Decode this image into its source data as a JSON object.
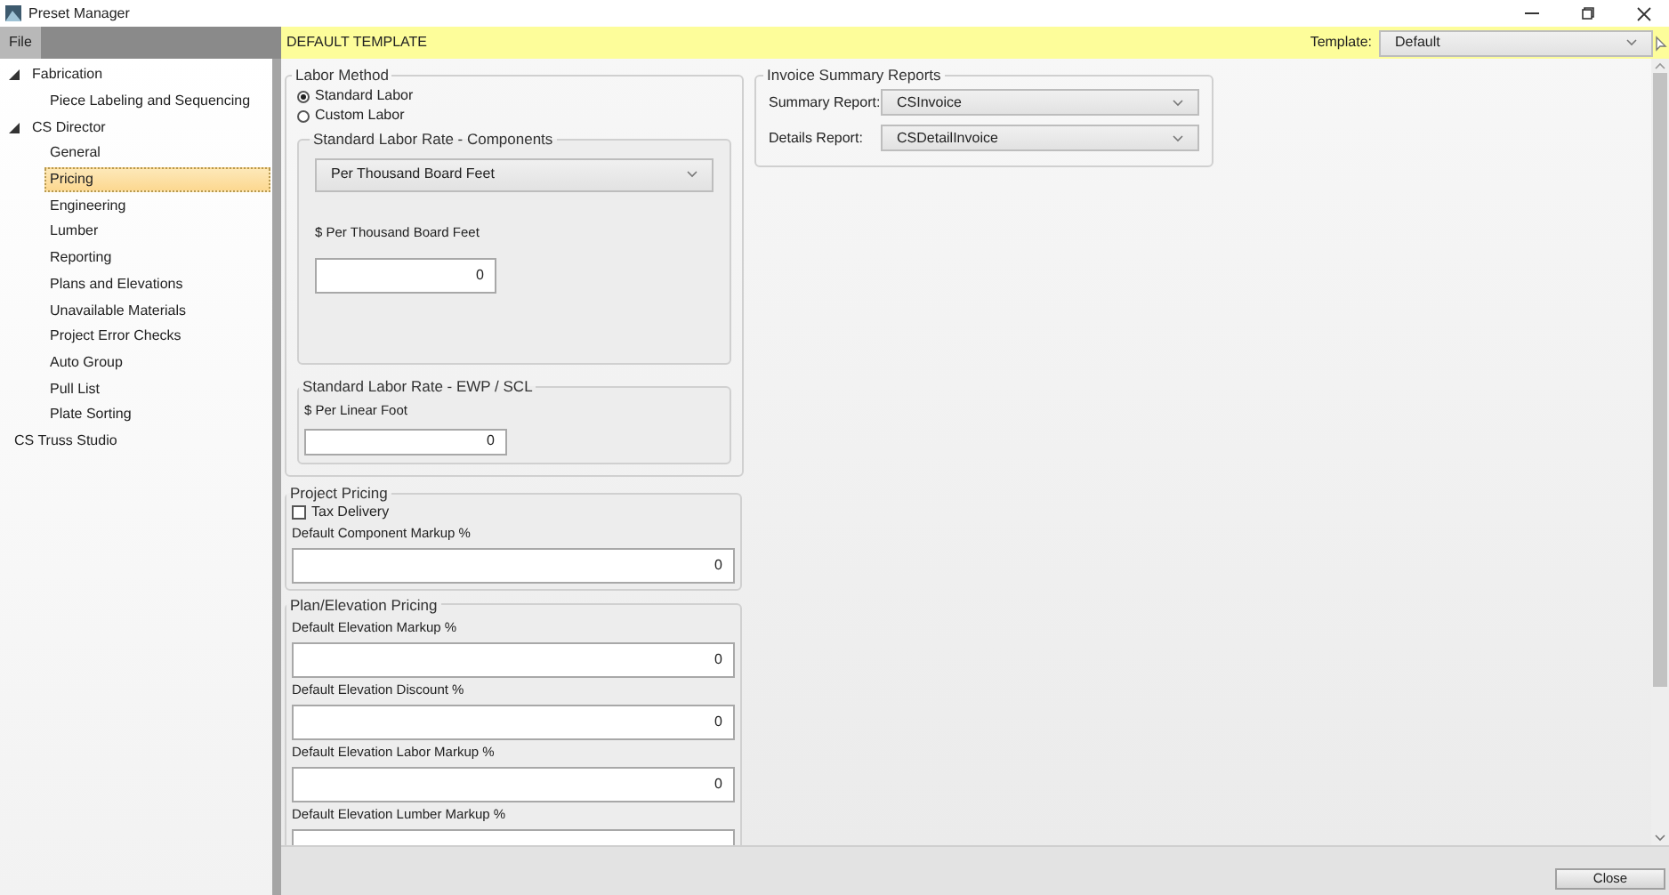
{
  "window": {
    "title": "Preset Manager"
  },
  "menu": {
    "label": "File"
  },
  "header": {
    "title": "DEFAULT TEMPLATE",
    "template_label": "Template:",
    "template_value": "Default"
  },
  "sidebar": {
    "items": [
      {
        "label": "Fabrication",
        "expanded": true,
        "selected": false,
        "children": [
          {
            "label": "Piece Labeling and Sequencing",
            "selected": false
          }
        ]
      },
      {
        "label": "CS Director",
        "expanded": true,
        "selected": false,
        "children": [
          {
            "label": "General",
            "selected": false
          },
          {
            "label": "Pricing",
            "selected": true
          },
          {
            "label": "Engineering",
            "selected": false
          },
          {
            "label": "Lumber",
            "selected": false
          },
          {
            "label": "Reporting",
            "selected": false
          },
          {
            "label": "Plans and Elevations",
            "selected": false
          },
          {
            "label": "Unavailable Materials",
            "selected": false
          },
          {
            "label": "Project Error Checks",
            "selected": false
          },
          {
            "label": "Auto Group",
            "selected": false
          },
          {
            "label": "Pull List",
            "selected": false
          },
          {
            "label": "Plate Sorting",
            "selected": false
          }
        ]
      },
      {
        "label": "CS Truss Studio",
        "selected": false
      }
    ]
  },
  "labor_method": {
    "title": "Labor Method",
    "options": [
      {
        "label": "Standard Labor",
        "selected": true
      },
      {
        "label": "Custom Labor",
        "selected": false
      }
    ],
    "components": {
      "title": "Standard Labor Rate - Components",
      "dropdown": "Per Thousand Board Feet",
      "field_label": "$ Per Thousand Board Feet",
      "value": "0"
    },
    "ewp": {
      "title": "Standard Labor Rate - EWP / SCL",
      "field_label": "$ Per Linear Foot",
      "value": "0"
    }
  },
  "project_pricing": {
    "title": "Project Pricing",
    "checkbox": {
      "label": "Tax Delivery",
      "checked": false
    },
    "fields": [
      {
        "label": "Default Component Markup %",
        "value": "0"
      }
    ]
  },
  "plan_elevation_pricing": {
    "title": "Plan/Elevation Pricing",
    "fields": [
      {
        "label": "Default Elevation Markup %",
        "value": "0"
      },
      {
        "label": "Default Elevation Discount %",
        "value": "0"
      },
      {
        "label": "Default Elevation Labor Markup %",
        "value": "0"
      },
      {
        "label": "Default Elevation Lumber Markup %"
      }
    ]
  },
  "invoice_reports": {
    "title": "Invoice Summary Reports",
    "rows": [
      {
        "label": "Summary Report:",
        "value": "CSInvoice"
      },
      {
        "label": "Details Report:",
        "value": "CSDetailInvoice"
      }
    ]
  },
  "footer": {
    "close": "Close"
  }
}
